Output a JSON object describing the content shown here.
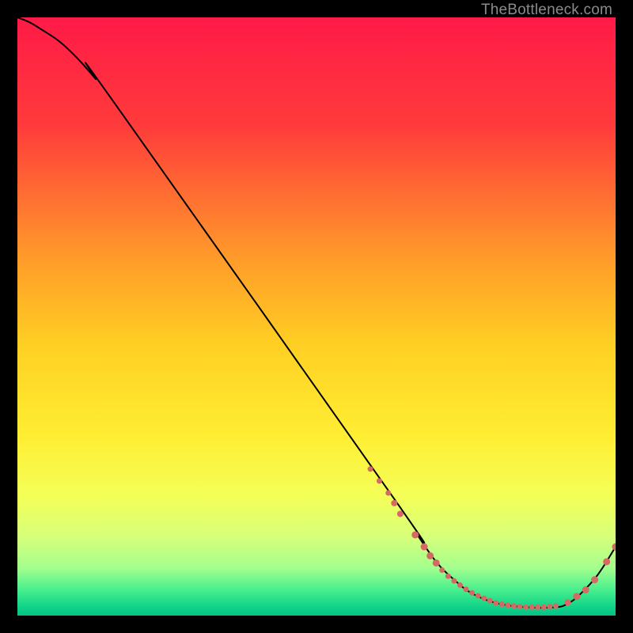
{
  "watermark": "TheBottleneck.com",
  "chart_data": {
    "type": "line",
    "title": "",
    "xlabel": "",
    "ylabel": "",
    "xlim": [
      0,
      100
    ],
    "ylim": [
      0,
      100
    ],
    "grid": false,
    "legend": false,
    "gradient_stops": [
      {
        "pos": 0.0,
        "color": "#ff1a47"
      },
      {
        "pos": 0.18,
        "color": "#ff3b3b"
      },
      {
        "pos": 0.4,
        "color": "#ff9a2a"
      },
      {
        "pos": 0.55,
        "color": "#ffd023"
      },
      {
        "pos": 0.7,
        "color": "#ffee33"
      },
      {
        "pos": 0.8,
        "color": "#f4ff58"
      },
      {
        "pos": 0.87,
        "color": "#d6ff7a"
      },
      {
        "pos": 0.92,
        "color": "#a4ff8e"
      },
      {
        "pos": 0.955,
        "color": "#4cf08e"
      },
      {
        "pos": 0.985,
        "color": "#11d488"
      },
      {
        "pos": 1.0,
        "color": "#06c183"
      }
    ],
    "series": [
      {
        "name": "curve",
        "type": "line",
        "color": "#000000",
        "x": [
          0,
          2,
          4,
          7,
          10,
          13,
          16,
          63,
          67,
          70,
          73,
          76,
          80,
          85,
          90,
          92,
          94,
          97,
          100
        ],
        "y": [
          100,
          99.2,
          98.0,
          96.0,
          93.2,
          89.8,
          86.0,
          19.5,
          13.3,
          9.0,
          6.0,
          3.7,
          2.1,
          1.4,
          1.4,
          2.0,
          3.5,
          6.8,
          11.5
        ]
      },
      {
        "name": "dots",
        "type": "scatter",
        "color": "#d46a63",
        "x": [
          59,
          60.5,
          62,
          63,
          64,
          66.5,
          68,
          69,
          70,
          71,
          72,
          73,
          74,
          75,
          76,
          77,
          78,
          79,
          80,
          81,
          82,
          83,
          84,
          85,
          86,
          87,
          88,
          89,
          90,
          92,
          93.5,
          95,
          96.5,
          98.5,
          100
        ],
        "y": [
          24.5,
          22.5,
          20.5,
          18.8,
          17.0,
          13.5,
          11.5,
          10.0,
          8.8,
          7.6,
          6.6,
          5.8,
          5.1,
          4.4,
          3.8,
          3.3,
          2.9,
          2.5,
          2.1,
          1.9,
          1.7,
          1.6,
          1.5,
          1.4,
          1.4,
          1.4,
          1.4,
          1.5,
          1.6,
          2.2,
          3.2,
          4.3,
          6.0,
          9.0,
          11.5
        ],
        "r": [
          3.5,
          3.5,
          3.5,
          4.0,
          4.0,
          4.5,
          4.5,
          4.5,
          4.5,
          3.5,
          3.5,
          3.5,
          3.5,
          3.5,
          3.5,
          3.5,
          3.5,
          3.5,
          3.5,
          3.5,
          3.5,
          3.5,
          3.5,
          3.5,
          3.5,
          3.5,
          3.5,
          3.5,
          3.5,
          4.0,
          4.5,
          4.5,
          4.5,
          4.5,
          4.5
        ]
      }
    ]
  }
}
